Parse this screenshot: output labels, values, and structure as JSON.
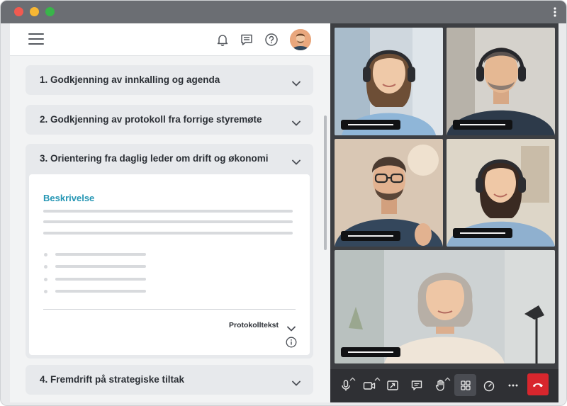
{
  "app": {
    "toolbar": {
      "menu_icon": "hamburger-icon",
      "notifications_icon": "bell-icon",
      "chat_icon": "chat-icon",
      "help_icon": "help-circle-icon",
      "avatar_icon": "user-avatar"
    }
  },
  "agenda": {
    "items": [
      {
        "label": "1. Godkjenning av innkalling og agenda",
        "expanded": false
      },
      {
        "label": "2. Godkjenning av protokoll fra forrige styremøte",
        "expanded": false
      },
      {
        "label": "3. Orientering fra daglig leder om drift og økonomi",
        "expanded": true
      },
      {
        "label": "4. Fremdrift på strategiske tiltak",
        "expanded": false
      }
    ],
    "expanded_card": {
      "heading": "Beskrivelse",
      "protocol_label": "Protokolltekst",
      "info_icon": "info-icon"
    }
  },
  "video": {
    "participants": 5,
    "controls": [
      {
        "name": "microphone-icon",
        "has_menu": true
      },
      {
        "name": "camera-icon",
        "has_menu": true
      },
      {
        "name": "share-screen-icon",
        "has_menu": false
      },
      {
        "name": "chat-icon",
        "has_menu": false
      },
      {
        "name": "raise-hand-icon",
        "has_menu": true
      },
      {
        "name": "grid-view-icon",
        "has_menu": false,
        "active": true
      },
      {
        "name": "performance-icon",
        "has_menu": false
      },
      {
        "name": "more-icon",
        "has_menu": false
      },
      {
        "name": "hang-up-icon",
        "has_menu": false
      }
    ]
  },
  "colors": {
    "accent": "#2596b4",
    "hangup": "#d8262d",
    "titlebar": "#6b6e73"
  }
}
